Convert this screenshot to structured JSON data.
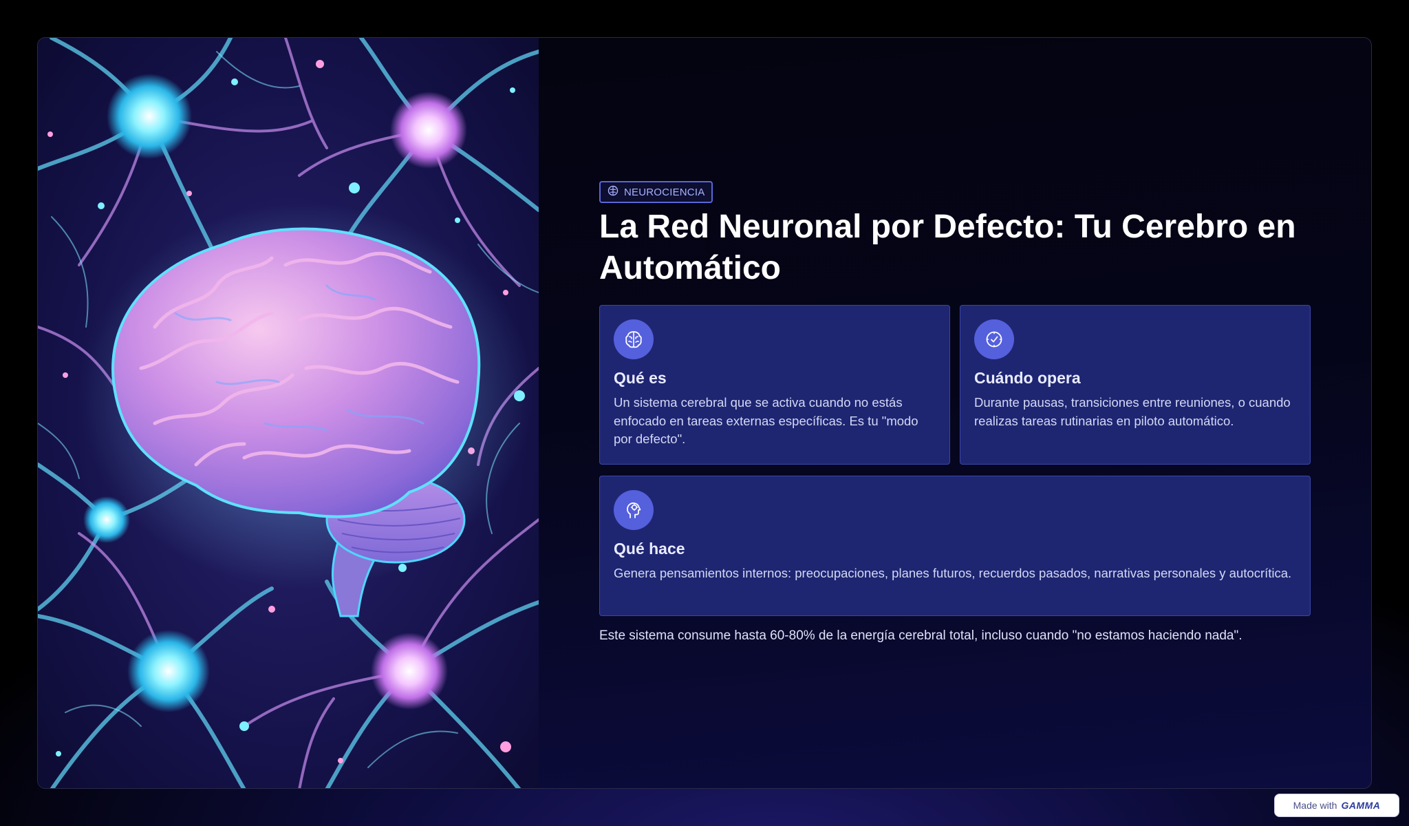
{
  "slide": {
    "tag": {
      "icon": "brain-icon",
      "label": "NEUROCIENCIA"
    },
    "title": "La Red Neuronal por Defecto: Tu Cerebro en Automático",
    "cards": [
      {
        "icon": "brain-icon",
        "title": "Qué es",
        "text": "Un sistema cerebral que se activa cuando no estás enfocado en tareas externas específicas. Es tu \"modo por defecto\"."
      },
      {
        "icon": "clock-icon",
        "title": "Cuándo opera",
        "text": "Durante pausas, transiciones entre reuniones, o cuando realizas tareas rutinarias en piloto automático."
      },
      {
        "icon": "head-thought-icon",
        "title": "Qué hace",
        "text": "Genera pensamientos internos: preocupaciones, planes futuros, recuerdos pasados, narrativas personales y autocrítica."
      }
    ],
    "footnote": "Este sistema consume hasta 60-80% de la energía cerebral total, incluso cuando \"no estamos haciendo nada\".",
    "illustration": {
      "icon": "glowing-brain-neurons-illustration"
    }
  },
  "badge": {
    "prefix": "Made with",
    "logo": "GAMMA"
  },
  "colors": {
    "background": "#000000",
    "card": "#1e2672",
    "card_border": "#3a46a8",
    "icon_circle": "#5560dd",
    "tag_border": "#5a67d8",
    "tag_text": "#a7b2ff",
    "title": "#ffffff"
  }
}
